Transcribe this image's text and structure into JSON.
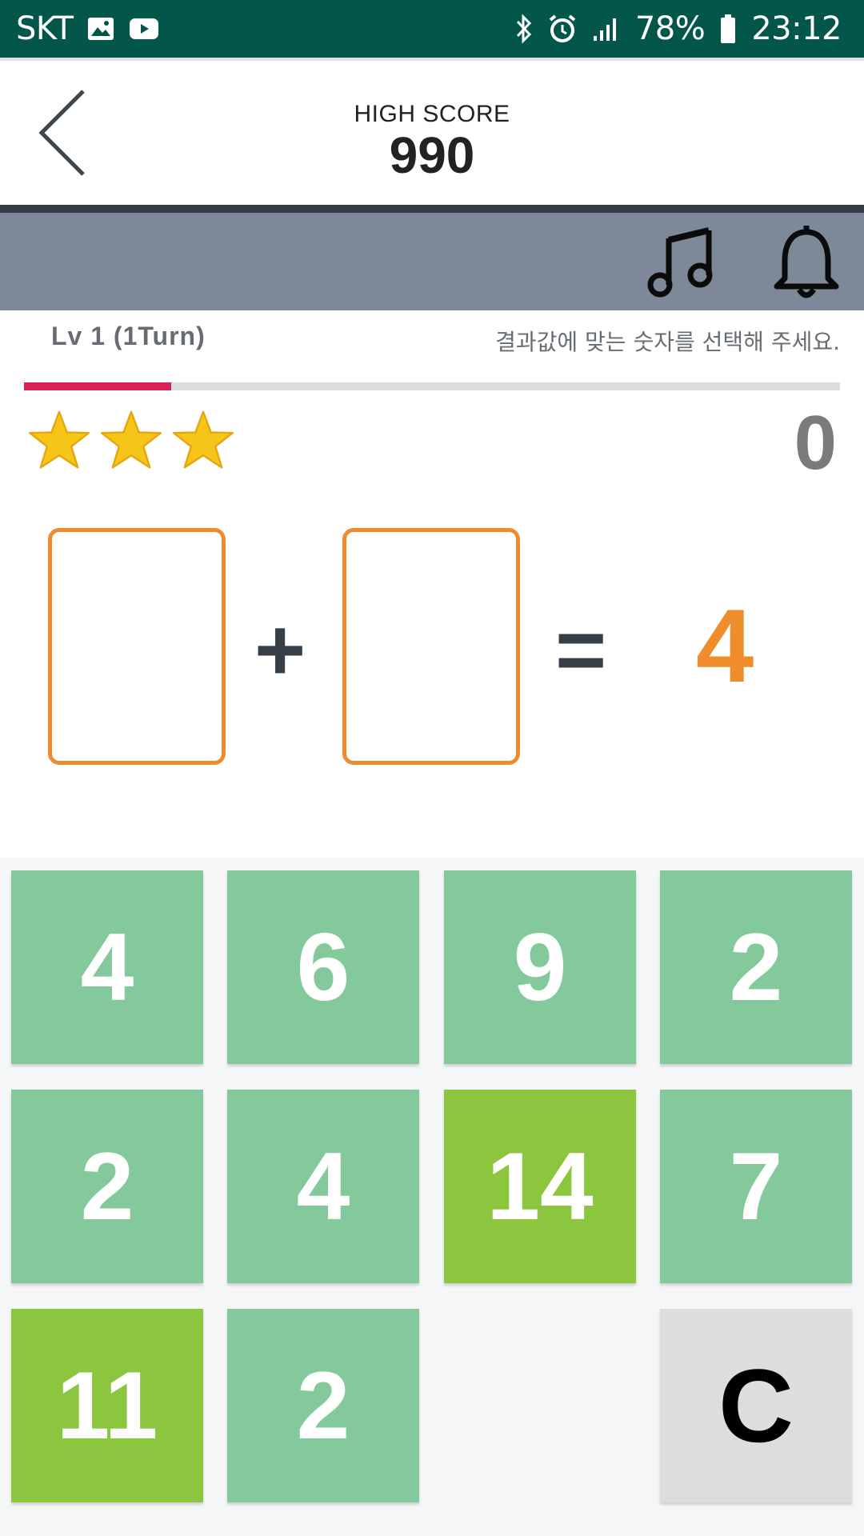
{
  "status_bar": {
    "carrier": "SKT",
    "battery": "78%",
    "time": "23:12",
    "icons": [
      "gallery-icon",
      "youtube-icon",
      "bluetooth-icon",
      "alarm-icon",
      "signal-icon",
      "battery-icon"
    ]
  },
  "header": {
    "high_score_label": "HIGH SCORE",
    "high_score_value": "990",
    "back_icon": "chevron-left-icon"
  },
  "toolbar": {
    "music_icon": "music-note-icon",
    "bell_icon": "bell-icon"
  },
  "level": {
    "label": "Lv 1 (1Turn)",
    "instruction": "결과값에 맞는 숫자를 선택해 주세요.",
    "progress_fraction": 0.18
  },
  "stars": {
    "count": 3,
    "color": "#f5c518"
  },
  "score": {
    "current": "0"
  },
  "equation": {
    "operator": "+",
    "equals": "=",
    "target": "4"
  },
  "keypad": {
    "keys": [
      {
        "label": "4",
        "style": "normal"
      },
      {
        "label": "6",
        "style": "normal"
      },
      {
        "label": "9",
        "style": "normal"
      },
      {
        "label": "2",
        "style": "normal"
      },
      {
        "label": "2",
        "style": "normal"
      },
      {
        "label": "4",
        "style": "normal"
      },
      {
        "label": "14",
        "style": "highlight"
      },
      {
        "label": "7",
        "style": "normal"
      },
      {
        "label": "11",
        "style": "highlight"
      },
      {
        "label": "2",
        "style": "normal"
      },
      {
        "label": "C",
        "style": "clear"
      }
    ]
  },
  "colors": {
    "status_bar": "#02574a",
    "toolbar": "#7d8898",
    "accent_orange": "#ef8c2c",
    "progress": "#d42457",
    "key_normal": "#83c99c",
    "key_highlight": "#8cc63f",
    "key_clear": "#dddddd"
  }
}
